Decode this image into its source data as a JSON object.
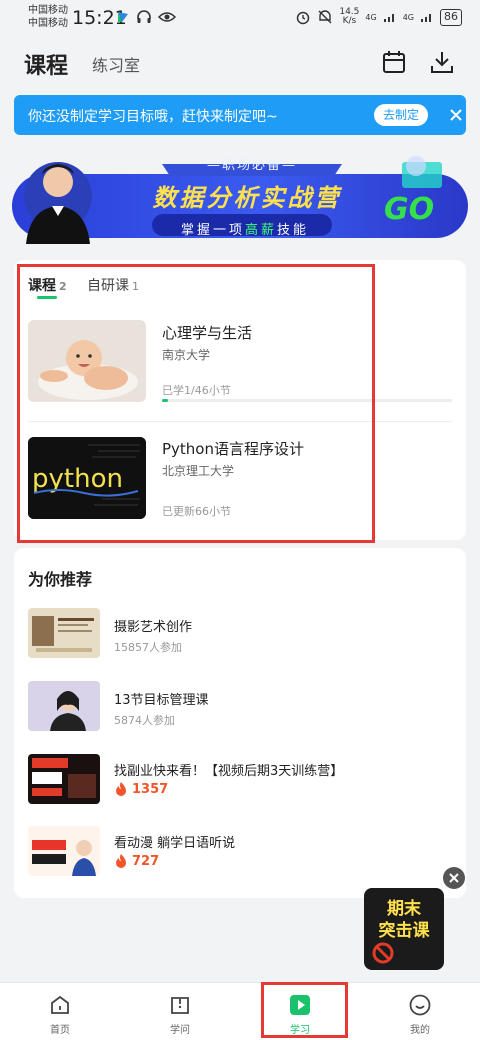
{
  "status_bar": {
    "carrier1": "中国移动",
    "carrier2": "中国移动",
    "time": "15:21",
    "net_speed": "14.5",
    "net_unit": "K/s",
    "battery": "86",
    "sig_label": "4G",
    "sig_label2": "4G"
  },
  "header": {
    "title": "课程",
    "subtitle": "练习室",
    "calendar_icon": "calendar-icon",
    "download_icon": "download-icon"
  },
  "notice": {
    "text": "你还没制定学习目标哦，赶快来制定吧~",
    "button": "去制定",
    "accent": "#1f9cf6"
  },
  "banner": {
    "small_text": "—职场必备—",
    "main_text": "数据分析实战营",
    "sub_text_1": "掌握一项",
    "sub_text_hl": "高薪",
    "sub_text_2": "技能",
    "go_text": "GO"
  },
  "courses": {
    "tabs": [
      {
        "label": "课程",
        "count": "2"
      },
      {
        "label": "自研课",
        "count": "1"
      }
    ],
    "items": [
      {
        "title": "心理学与生活",
        "school": "南京大学",
        "progress_text": "已学1/46小节",
        "progress": 0.02
      },
      {
        "title": "Python语言程序设计",
        "school": "北京理工大学",
        "progress_text": "已更新66小节",
        "thumb_text": "python"
      }
    ],
    "accent": "#19c26b"
  },
  "recommend": {
    "heading": "为你推荐",
    "items": [
      {
        "title": "摄影艺术创作",
        "meta": "15857人参加"
      },
      {
        "title": "13节目标管理课",
        "meta": "5874人参加"
      },
      {
        "title": "找副业快来看！【视频后期3天训练营】",
        "hot": "1357"
      },
      {
        "title": "看动漫 躺学日语听说",
        "hot": "727"
      }
    ],
    "hot_color": "#f2552c"
  },
  "promo": {
    "line1": "期末",
    "line2": "突击课"
  },
  "bottom_nav": {
    "items": [
      {
        "label": "首页",
        "icon": "home-icon"
      },
      {
        "label": "学问",
        "icon": "book-icon"
      },
      {
        "label": "学习",
        "icon": "play-icon"
      },
      {
        "label": "我的",
        "icon": "smile-icon"
      }
    ],
    "active": "学习"
  }
}
